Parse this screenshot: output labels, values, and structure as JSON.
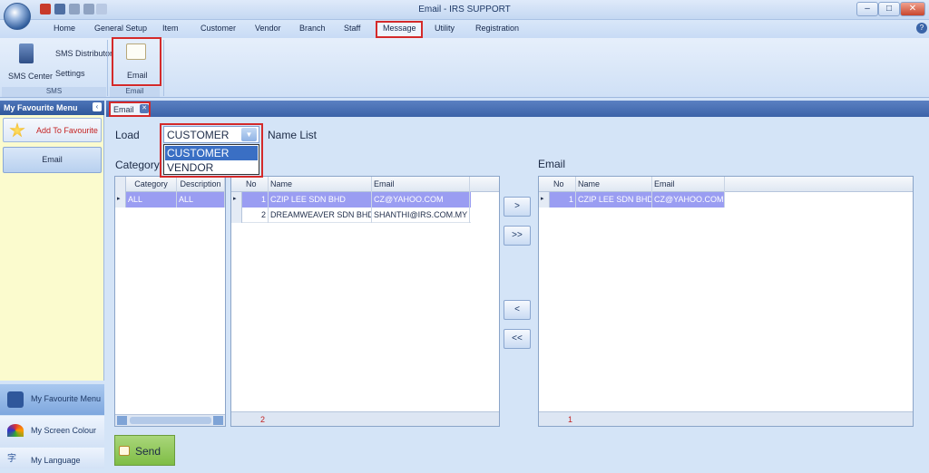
{
  "window": {
    "title": "Email - IRS SUPPORT",
    "min": "–",
    "max": "□",
    "close": "✕",
    "help": "?"
  },
  "menu": {
    "tabs": [
      "Home",
      "General Setup",
      "Item",
      "Customer",
      "Vendor",
      "Branch",
      "Staff",
      "Message",
      "Utility",
      "Registration"
    ],
    "active": "Message"
  },
  "ribbon": {
    "sms_center": "SMS Center",
    "sms_distributor": "SMS Distributor",
    "settings": "Settings",
    "sms_group": "SMS",
    "email_button": "Email",
    "email_group": "Email"
  },
  "sidebar": {
    "header": "My Favourite Menu",
    "add_favourite": "Add To Favourite",
    "email_item": "Email",
    "nav": [
      "My Favourite Menu",
      "My Screen Colour",
      "My Language"
    ]
  },
  "doc_tab": {
    "label": "Email",
    "close": "✕"
  },
  "load": {
    "label": "Load",
    "selected": "CUSTOMER",
    "options": [
      "CUSTOMER",
      "VENDOR"
    ],
    "name_list_label": "Name List"
  },
  "category": {
    "label": "Category",
    "columns": [
      "Category",
      "Description"
    ],
    "rows": [
      {
        "category": "ALL",
        "description": "ALL"
      }
    ]
  },
  "names": {
    "columns": [
      "No",
      "Name",
      "Email"
    ],
    "rows": [
      {
        "no": "1",
        "name": "CZIP LEE SDN BHD",
        "email": "CZ@YAHOO.COM"
      },
      {
        "no": "2",
        "name": "DREAMWEAVER SDN BHD",
        "email": "SHANTHI@IRS.COM.MY"
      }
    ],
    "count": "2"
  },
  "move": {
    "add": ">",
    "add_all": ">>",
    "remove": "<",
    "remove_all": "<<"
  },
  "email_list": {
    "label": "Email",
    "columns": [
      "No",
      "Name",
      "Email"
    ],
    "rows": [
      {
        "no": "1",
        "name": "CZIP LEE SDN BHD",
        "email": "CZ@YAHOO.COM"
      }
    ],
    "count": "1"
  },
  "send": {
    "label": "Send"
  },
  "colors": {
    "accent": "#d42a2a",
    "selection": "#9a9df2",
    "send": "#7fbd46"
  }
}
